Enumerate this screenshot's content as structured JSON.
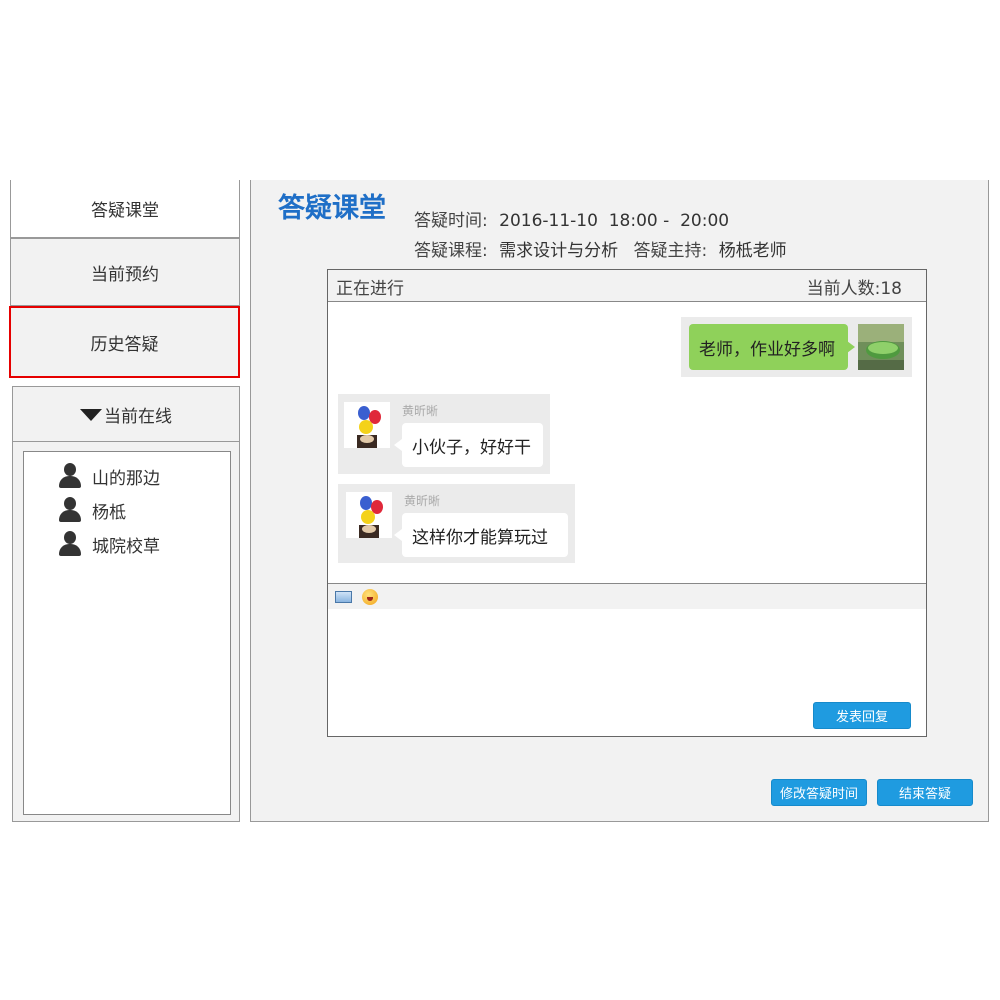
{
  "sidebar": {
    "items": [
      {
        "label": "答疑课堂"
      },
      {
        "label": "当前预约"
      },
      {
        "label": "历史答疑"
      }
    ],
    "online_header": "当前在线",
    "online_users": [
      "山的那边",
      "杨柢",
      "城院校草"
    ]
  },
  "main": {
    "title": "答疑课堂",
    "time_label": "答疑时间:",
    "time_value": "2016-11-10  18:00 -  20:00",
    "course_label": "答疑课程:",
    "course_value": "需求设计与分析",
    "host_label": "答疑主持:",
    "host_value": "杨柢老师"
  },
  "chat": {
    "status": "正在进行",
    "count": "当前人数:18",
    "messages": [
      {
        "text": "老师，作业好多啊"
      },
      {
        "sender": "黄昕晰",
        "text": "小伙子，好好干"
      },
      {
        "sender": "黄昕晰",
        "text": "这样你才能算玩过"
      }
    ],
    "send_button": "发表回复"
  },
  "actions": {
    "modify_time": "修改答疑时间",
    "end": "结束答疑"
  },
  "colors": {
    "accent": "#1f9be0",
    "title": "#1f6fc7",
    "active_border": "#e60000",
    "bubble_green": "#8fd15a"
  }
}
